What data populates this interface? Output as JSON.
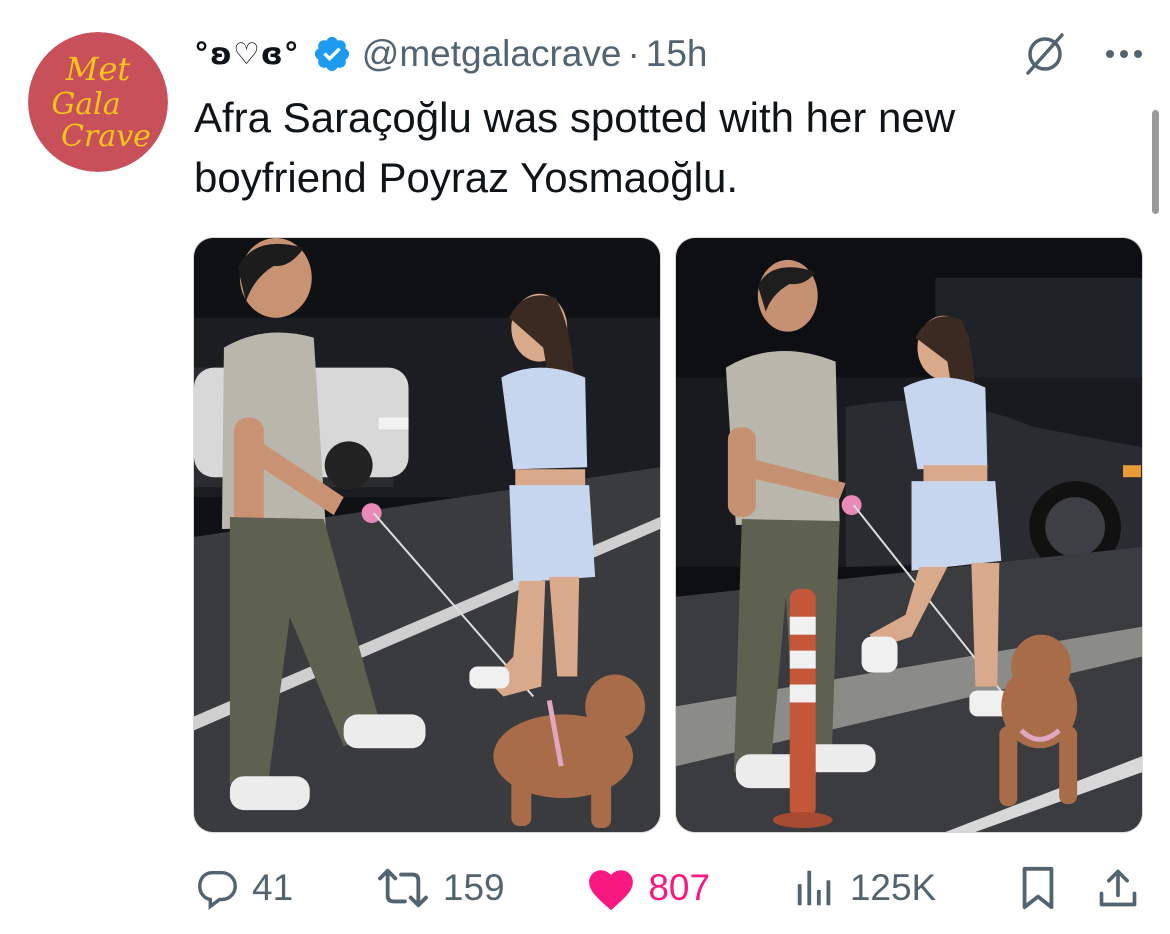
{
  "author": {
    "avatar_text": [
      "Met",
      "Gala",
      "Crave"
    ],
    "display_name": "°ʚ♡ɞ°",
    "verified": true,
    "handle": "@metgalacrave",
    "separator": "·",
    "time": "15h"
  },
  "tweet": {
    "text": "Afra Saraçoğlu was spotted with her new\nboyfriend Poyraz Yosmaoğlu."
  },
  "media": [
    {
      "name": "photo-1",
      "description_icon": "photo"
    },
    {
      "name": "photo-2",
      "description_icon": "photo"
    }
  ],
  "actions": {
    "replies": "41",
    "reposts": "159",
    "likes": "807",
    "views": "125K"
  },
  "colors": {
    "accent": "#1d9bf0",
    "like": "#f91880",
    "muted": "#536471",
    "avatar_bg": "#c8505a",
    "avatar_text": "#f5c518"
  },
  "icons": {
    "verified": "verified-badge-icon",
    "grok": "grok-icon",
    "more": "more-icon",
    "reply": "reply-icon",
    "repost": "repost-icon",
    "like": "heart-icon",
    "views": "views-icon",
    "bookmark": "bookmark-icon",
    "share": "share-icon"
  }
}
